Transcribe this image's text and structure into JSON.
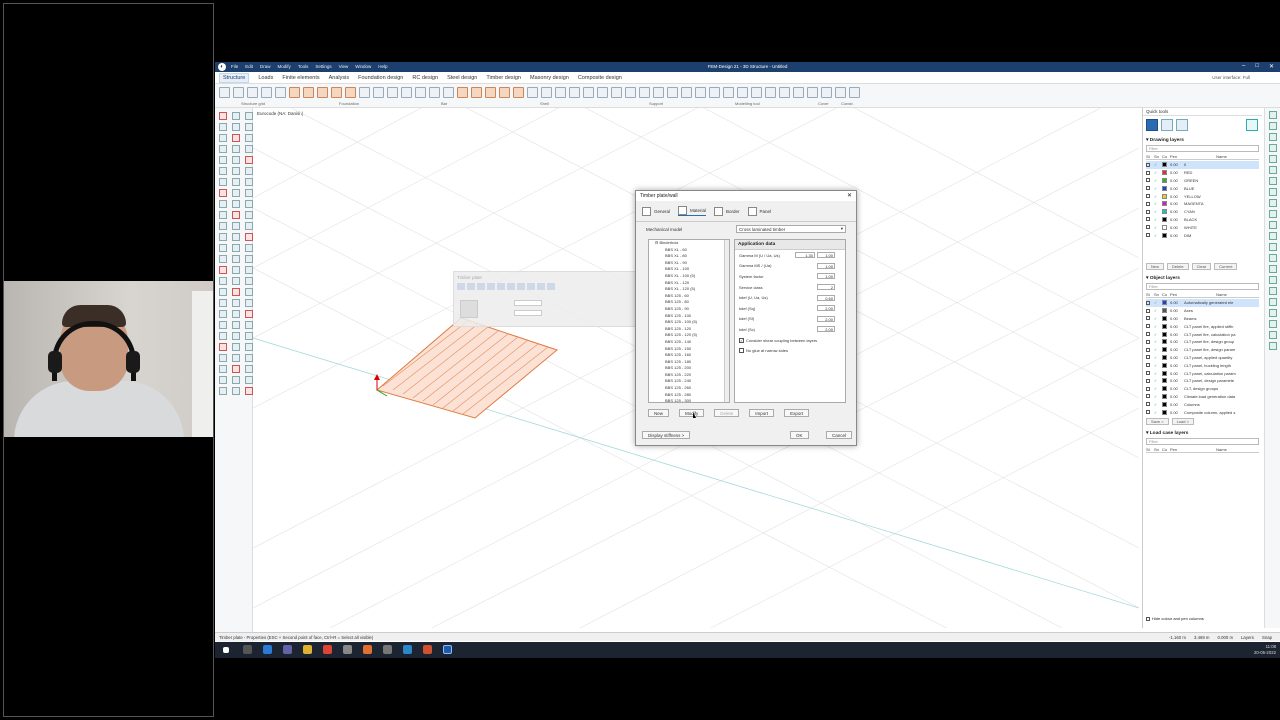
{
  "app": {
    "title": "FEM-Design 21 - 3D Structure - Untitled",
    "menu": [
      "File",
      "Edit",
      "Draw",
      "Modify",
      "Tools",
      "Settings",
      "View",
      "Window",
      "Help"
    ],
    "ribbon_tabs": [
      "Structure",
      "Loads",
      "Finite elements",
      "Analysis",
      "Foundation design",
      "RC design",
      "Steel design",
      "Timber design",
      "Masonry design",
      "Composite design"
    ],
    "active_tab": "Structure",
    "user_interface_label": "User interface",
    "user_interface_value": "Full",
    "toolbar_groups": [
      "Structure grid",
      "Foundation",
      "Bar",
      "Shell",
      "Support",
      "Modelling tool",
      "Cover",
      "Constr."
    ],
    "viewport_standard": "Eurocode (NA: Danish)"
  },
  "dialog": {
    "title": "Timber plate/wall",
    "tabs": [
      "General",
      "Material",
      "Border",
      "Panel"
    ],
    "active_tab": "Material",
    "mechanical_model_label": "Mechanical model",
    "mechanical_model_value": "Cross laminated timber",
    "tree_root": "Binderholz",
    "tree_items": [
      "BBS XL - 60",
      "BBS XL - 80",
      "BBS XL - 90",
      "BBS XL - 100",
      "BBS XL - 100 (5)",
      "BBS XL - 120",
      "BBS XL - 120 (5)",
      "BBS 125 - 60",
      "BBS 125 - 80",
      "BBS 125 - 90",
      "BBS 125 - 100",
      "BBS 125 - 100 (5)",
      "BBS 125 - 120",
      "BBS 125 - 120 (5)",
      "BBS 125 - 140",
      "BBS 125 - 150",
      "BBS 125 - 160",
      "BBS 125 - 180",
      "BBS 125 - 200",
      "BBS 125 - 220",
      "BBS 125 - 240",
      "BBS 125 - 260",
      "BBS 125 - 280",
      "BBS 125 - 300"
    ],
    "application_data_title": "Application data",
    "rows": [
      {
        "label": "Gamma M (U / Ua, Us)",
        "v1": "1.30",
        "v2": "1.00"
      },
      {
        "label": "Gamma MS / (Ua)",
        "v1": "",
        "v2": "1.00"
      },
      {
        "label": "System factor",
        "v1": "",
        "v2": "1.00"
      },
      {
        "label": "Service class",
        "v1": "",
        "v2": "2"
      },
      {
        "label": "kdef (U, Ua, Us)",
        "v1": "",
        "v2": "0.60"
      },
      {
        "label": "kdef (Sq)",
        "v1": "",
        "v2": "2.00"
      },
      {
        "label": "kdef (Sf)",
        "v1": "",
        "v2": "2.00"
      },
      {
        "label": "kdef (Sc)",
        "v1": "",
        "v2": "2.00"
      }
    ],
    "checkboxes": [
      "Consider shear coupling between layers",
      "No glue at narrow sides"
    ],
    "buttons": [
      "New",
      "Modify",
      "Delete",
      "Import",
      "Export"
    ],
    "display_stiffness": "Display stiffness >",
    "ok": "OK",
    "cancel": "Cancel"
  },
  "ghost_dialog": {
    "title": "Timber plate"
  },
  "right_panel": {
    "title": "Quick tools",
    "drawing_layers_title": "Drawing layers",
    "filter_placeholder": "Filter",
    "columns": [
      "St",
      "Sn",
      "Co",
      "Pen",
      "Name"
    ],
    "drawing_layers": [
      {
        "pen": "0.00",
        "name": "0",
        "color": "#000000",
        "selected": true
      },
      {
        "pen": "0.00",
        "name": "RED",
        "color": "#e53030"
      },
      {
        "pen": "0.00",
        "name": "GREEN",
        "color": "#30b030"
      },
      {
        "pen": "0.00",
        "name": "BLUE",
        "color": "#2040d0"
      },
      {
        "pen": "0.00",
        "name": "YELLOW",
        "color": "#e6d020"
      },
      {
        "pen": "0.00",
        "name": "MAGENTA",
        "color": "#d020c0"
      },
      {
        "pen": "0.00",
        "name": "CYAN",
        "color": "#20c0d0"
      },
      {
        "pen": "0.00",
        "name": "BLACK",
        "color": "#000000"
      },
      {
        "pen": "0.00",
        "name": "WHITE",
        "color": "#ffffff"
      },
      {
        "pen": "0.00",
        "name": "DIM",
        "color": "#000000"
      }
    ],
    "drawing_buttons": [
      "New",
      "Delete",
      "Clear",
      "Current"
    ],
    "object_layers_title": "Object layers",
    "object_layers": [
      {
        "pen": "0.00",
        "name": "Automatically generated ele",
        "color": "#2040d0",
        "selected": true
      },
      {
        "pen": "0.00",
        "name": "Axes",
        "color": "#555555"
      },
      {
        "pen": "0.00",
        "name": "Beams",
        "color": "#000000"
      },
      {
        "pen": "0.00",
        "name": "CLT panel fire, applied stiffn",
        "color": "#000000"
      },
      {
        "pen": "0.00",
        "name": "CLT panel fire, calculation pa",
        "color": "#000000"
      },
      {
        "pen": "0.00",
        "name": "CLT panel fire, design group",
        "color": "#000000"
      },
      {
        "pen": "0.00",
        "name": "CLT panel fire, design param",
        "color": "#000000"
      },
      {
        "pen": "0.00",
        "name": "CLT panel, applied quantity",
        "color": "#000000"
      },
      {
        "pen": "0.00",
        "name": "CLT panel, buckling length",
        "color": "#000000"
      },
      {
        "pen": "0.00",
        "name": "CLT panel, calculation param",
        "color": "#000000"
      },
      {
        "pen": "0.00",
        "name": "CLT panel, design paramete",
        "color": "#000000"
      },
      {
        "pen": "0.00",
        "name": "CLT, design groups",
        "color": "#000000"
      },
      {
        "pen": "0.00",
        "name": "Climate load generation data",
        "color": "#000000"
      },
      {
        "pen": "0.00",
        "name": "Columns",
        "color": "#000000"
      },
      {
        "pen": "0.00",
        "name": "Composite column, applied s",
        "color": "#000000"
      }
    ],
    "object_buttons": [
      "Save >",
      "Load >"
    ],
    "load_case_layers_title": "Load case layers",
    "hide_colour": "Hide colour and pen columns"
  },
  "status": {
    "left": "Timber plate - Properties (ESC + Second point of face, Ctrl+R = Select all visible)",
    "coords": [
      "-1.160 m",
      "3.469 m",
      "0.000 m"
    ],
    "layers": "Layers",
    "snap": "Snap"
  },
  "clock": {
    "time": "11:08",
    "date": "20-05-2022"
  },
  "viewport_caption": "Model 1"
}
